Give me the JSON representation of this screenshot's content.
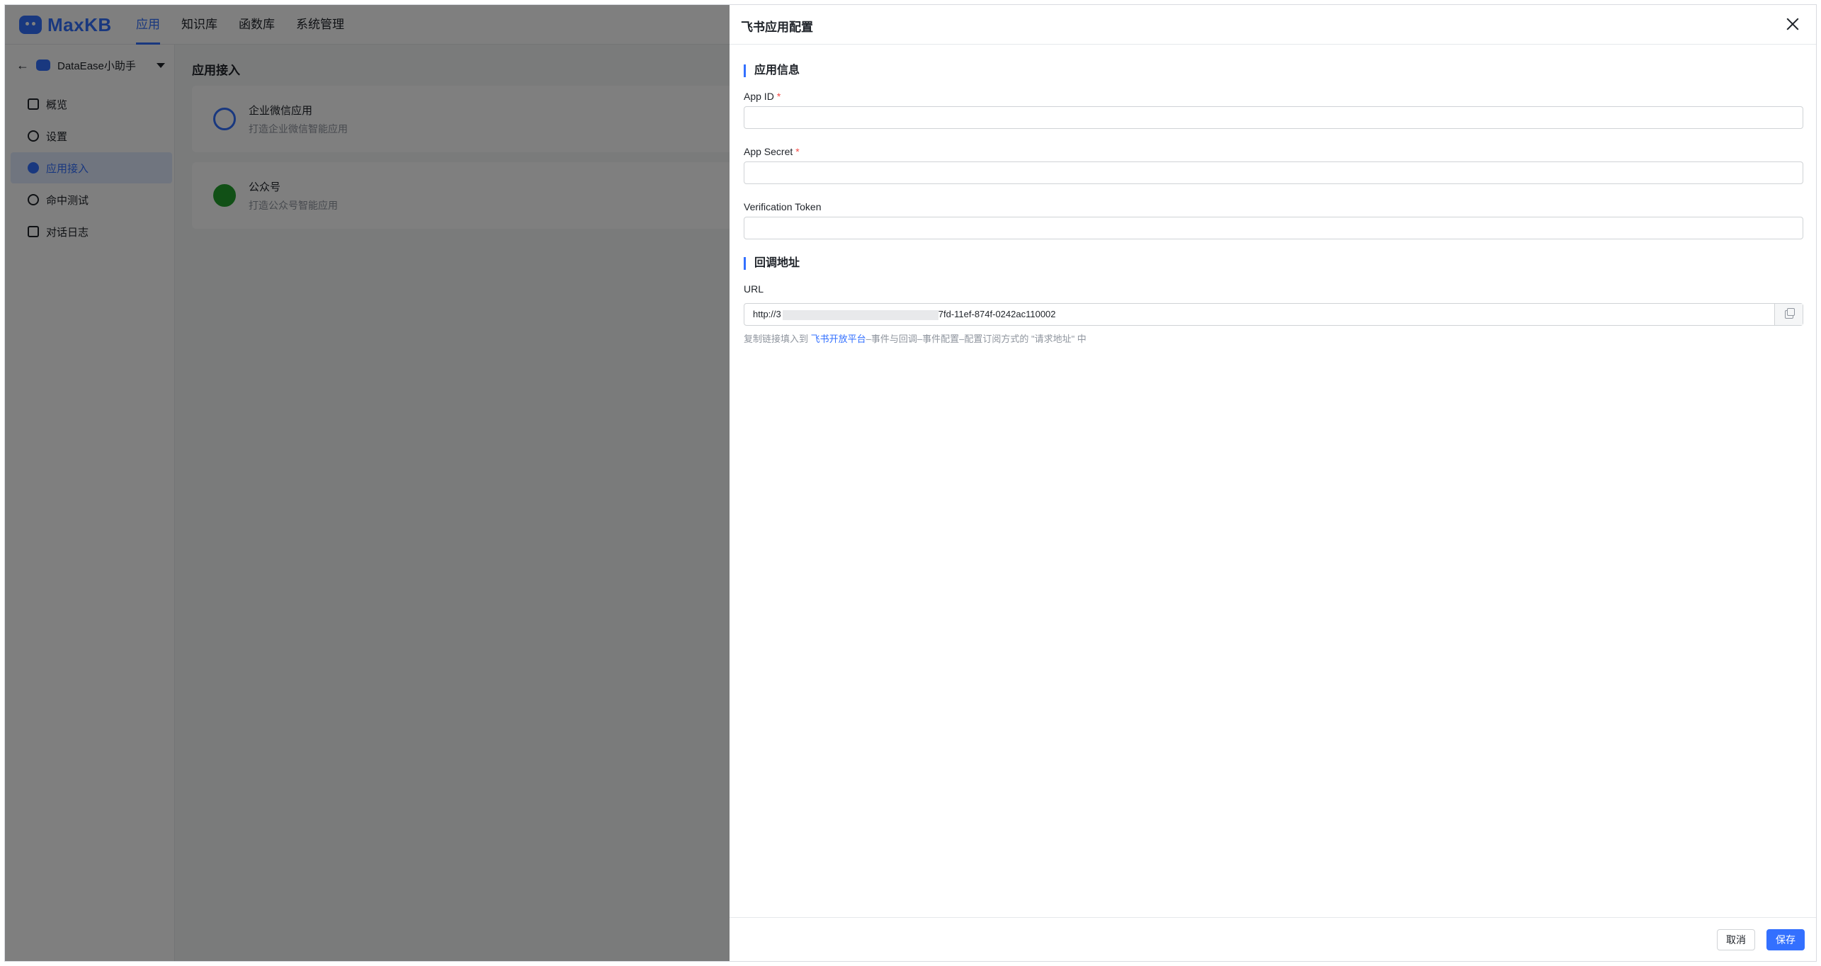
{
  "app": {
    "logo_text": "MaxKB"
  },
  "topnav": {
    "items": [
      "应用",
      "知识库",
      "函数库",
      "系统管理"
    ],
    "active": "应用"
  },
  "sidebar": {
    "app_name": "DataEase小助手",
    "items": [
      {
        "label": "概览",
        "icon": "grid-icon"
      },
      {
        "label": "设置",
        "icon": "gear-icon"
      },
      {
        "label": "应用接入",
        "icon": "plug-icon",
        "active": true
      },
      {
        "label": "命中测试",
        "icon": "target-icon"
      },
      {
        "label": "对话日志",
        "icon": "document-icon"
      }
    ]
  },
  "main": {
    "title": "应用接入",
    "cards": [
      {
        "title": "企业微信应用",
        "desc": "打造企业微信智能应用",
        "icon": "wecom-icon"
      },
      {
        "title": "公众号",
        "desc": "打造公众号智能应用",
        "icon": "wechat-icon"
      }
    ]
  },
  "drawer": {
    "title": "飞书应用配置",
    "section_app_info": "应用信息",
    "app_id_label": "App ID",
    "app_id_value": "",
    "app_secret_label": "App Secret",
    "app_secret_value": "",
    "verification_token_label": "Verification Token",
    "verification_token_value": "",
    "required_mark": "*",
    "section_callback": "回调地址",
    "url_label": "URL",
    "url_prefix": "http://3",
    "url_suffix": "7fd-11ef-874f-0242ac110002",
    "hint_prefix": "复制链接填入到",
    "hint_link": "飞书开放平台",
    "hint_suffix": "–事件与回调–事件配置–配置订阅方式的 \"请求地址\" 中",
    "cancel_label": "取消",
    "save_label": "保存"
  },
  "colors": {
    "primary": "#3370ff",
    "required": "#f54a45",
    "overlay": "rgba(0,0,0,0.5)"
  }
}
